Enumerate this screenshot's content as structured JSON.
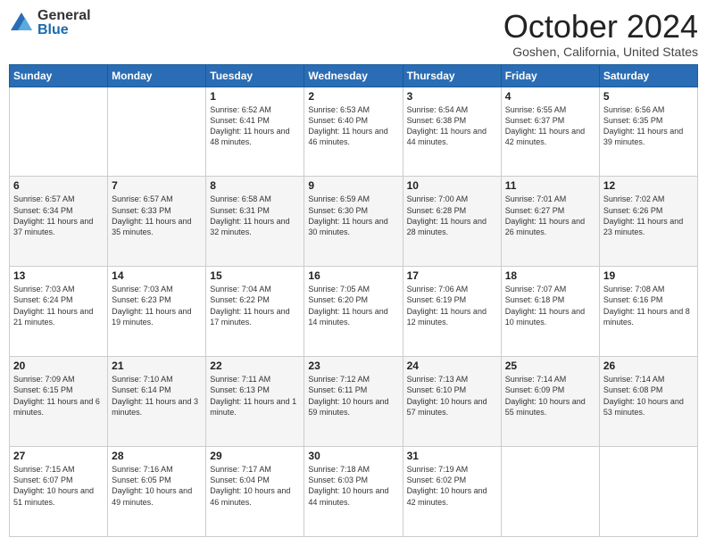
{
  "header": {
    "logo_general": "General",
    "logo_blue": "Blue",
    "month": "October 2024",
    "location": "Goshen, California, United States"
  },
  "days_of_week": [
    "Sunday",
    "Monday",
    "Tuesday",
    "Wednesday",
    "Thursday",
    "Friday",
    "Saturday"
  ],
  "weeks": [
    [
      {
        "day": "",
        "sunrise": "",
        "sunset": "",
        "daylight": ""
      },
      {
        "day": "",
        "sunrise": "",
        "sunset": "",
        "daylight": ""
      },
      {
        "day": "1",
        "sunrise": "Sunrise: 6:52 AM",
        "sunset": "Sunset: 6:41 PM",
        "daylight": "Daylight: 11 hours and 48 minutes."
      },
      {
        "day": "2",
        "sunrise": "Sunrise: 6:53 AM",
        "sunset": "Sunset: 6:40 PM",
        "daylight": "Daylight: 11 hours and 46 minutes."
      },
      {
        "day": "3",
        "sunrise": "Sunrise: 6:54 AM",
        "sunset": "Sunset: 6:38 PM",
        "daylight": "Daylight: 11 hours and 44 minutes."
      },
      {
        "day": "4",
        "sunrise": "Sunrise: 6:55 AM",
        "sunset": "Sunset: 6:37 PM",
        "daylight": "Daylight: 11 hours and 42 minutes."
      },
      {
        "day": "5",
        "sunrise": "Sunrise: 6:56 AM",
        "sunset": "Sunset: 6:35 PM",
        "daylight": "Daylight: 11 hours and 39 minutes."
      }
    ],
    [
      {
        "day": "6",
        "sunrise": "Sunrise: 6:57 AM",
        "sunset": "Sunset: 6:34 PM",
        "daylight": "Daylight: 11 hours and 37 minutes."
      },
      {
        "day": "7",
        "sunrise": "Sunrise: 6:57 AM",
        "sunset": "Sunset: 6:33 PM",
        "daylight": "Daylight: 11 hours and 35 minutes."
      },
      {
        "day": "8",
        "sunrise": "Sunrise: 6:58 AM",
        "sunset": "Sunset: 6:31 PM",
        "daylight": "Daylight: 11 hours and 32 minutes."
      },
      {
        "day": "9",
        "sunrise": "Sunrise: 6:59 AM",
        "sunset": "Sunset: 6:30 PM",
        "daylight": "Daylight: 11 hours and 30 minutes."
      },
      {
        "day": "10",
        "sunrise": "Sunrise: 7:00 AM",
        "sunset": "Sunset: 6:28 PM",
        "daylight": "Daylight: 11 hours and 28 minutes."
      },
      {
        "day": "11",
        "sunrise": "Sunrise: 7:01 AM",
        "sunset": "Sunset: 6:27 PM",
        "daylight": "Daylight: 11 hours and 26 minutes."
      },
      {
        "day": "12",
        "sunrise": "Sunrise: 7:02 AM",
        "sunset": "Sunset: 6:26 PM",
        "daylight": "Daylight: 11 hours and 23 minutes."
      }
    ],
    [
      {
        "day": "13",
        "sunrise": "Sunrise: 7:03 AM",
        "sunset": "Sunset: 6:24 PM",
        "daylight": "Daylight: 11 hours and 21 minutes."
      },
      {
        "day": "14",
        "sunrise": "Sunrise: 7:03 AM",
        "sunset": "Sunset: 6:23 PM",
        "daylight": "Daylight: 11 hours and 19 minutes."
      },
      {
        "day": "15",
        "sunrise": "Sunrise: 7:04 AM",
        "sunset": "Sunset: 6:22 PM",
        "daylight": "Daylight: 11 hours and 17 minutes."
      },
      {
        "day": "16",
        "sunrise": "Sunrise: 7:05 AM",
        "sunset": "Sunset: 6:20 PM",
        "daylight": "Daylight: 11 hours and 14 minutes."
      },
      {
        "day": "17",
        "sunrise": "Sunrise: 7:06 AM",
        "sunset": "Sunset: 6:19 PM",
        "daylight": "Daylight: 11 hours and 12 minutes."
      },
      {
        "day": "18",
        "sunrise": "Sunrise: 7:07 AM",
        "sunset": "Sunset: 6:18 PM",
        "daylight": "Daylight: 11 hours and 10 minutes."
      },
      {
        "day": "19",
        "sunrise": "Sunrise: 7:08 AM",
        "sunset": "Sunset: 6:16 PM",
        "daylight": "Daylight: 11 hours and 8 minutes."
      }
    ],
    [
      {
        "day": "20",
        "sunrise": "Sunrise: 7:09 AM",
        "sunset": "Sunset: 6:15 PM",
        "daylight": "Daylight: 11 hours and 6 minutes."
      },
      {
        "day": "21",
        "sunrise": "Sunrise: 7:10 AM",
        "sunset": "Sunset: 6:14 PM",
        "daylight": "Daylight: 11 hours and 3 minutes."
      },
      {
        "day": "22",
        "sunrise": "Sunrise: 7:11 AM",
        "sunset": "Sunset: 6:13 PM",
        "daylight": "Daylight: 11 hours and 1 minute."
      },
      {
        "day": "23",
        "sunrise": "Sunrise: 7:12 AM",
        "sunset": "Sunset: 6:11 PM",
        "daylight": "Daylight: 10 hours and 59 minutes."
      },
      {
        "day": "24",
        "sunrise": "Sunrise: 7:13 AM",
        "sunset": "Sunset: 6:10 PM",
        "daylight": "Daylight: 10 hours and 57 minutes."
      },
      {
        "day": "25",
        "sunrise": "Sunrise: 7:14 AM",
        "sunset": "Sunset: 6:09 PM",
        "daylight": "Daylight: 10 hours and 55 minutes."
      },
      {
        "day": "26",
        "sunrise": "Sunrise: 7:14 AM",
        "sunset": "Sunset: 6:08 PM",
        "daylight": "Daylight: 10 hours and 53 minutes."
      }
    ],
    [
      {
        "day": "27",
        "sunrise": "Sunrise: 7:15 AM",
        "sunset": "Sunset: 6:07 PM",
        "daylight": "Daylight: 10 hours and 51 minutes."
      },
      {
        "day": "28",
        "sunrise": "Sunrise: 7:16 AM",
        "sunset": "Sunset: 6:05 PM",
        "daylight": "Daylight: 10 hours and 49 minutes."
      },
      {
        "day": "29",
        "sunrise": "Sunrise: 7:17 AM",
        "sunset": "Sunset: 6:04 PM",
        "daylight": "Daylight: 10 hours and 46 minutes."
      },
      {
        "day": "30",
        "sunrise": "Sunrise: 7:18 AM",
        "sunset": "Sunset: 6:03 PM",
        "daylight": "Daylight: 10 hours and 44 minutes."
      },
      {
        "day": "31",
        "sunrise": "Sunrise: 7:19 AM",
        "sunset": "Sunset: 6:02 PM",
        "daylight": "Daylight: 10 hours and 42 minutes."
      },
      {
        "day": "",
        "sunrise": "",
        "sunset": "",
        "daylight": ""
      },
      {
        "day": "",
        "sunrise": "",
        "sunset": "",
        "daylight": ""
      }
    ]
  ]
}
